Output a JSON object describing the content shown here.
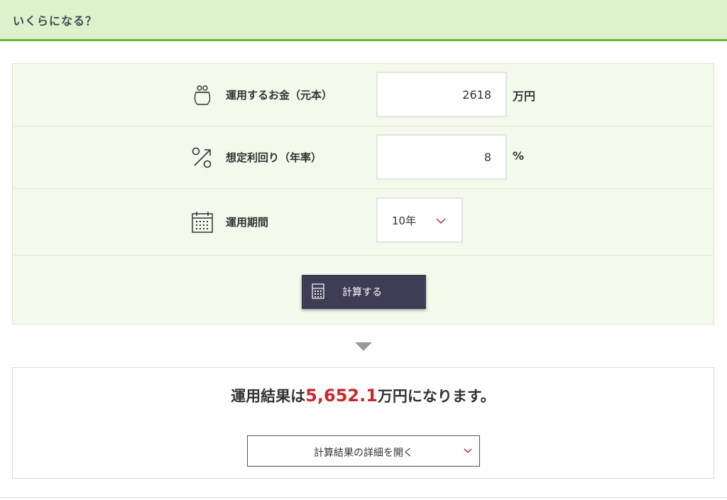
{
  "header": {
    "title": "いくらになる？"
  },
  "form": {
    "principal": {
      "label": "運用するお金（元本）",
      "value": "2618",
      "unit": "万円",
      "icon": "purse-icon"
    },
    "rate": {
      "label": "想定利回り（年率）",
      "value": "8",
      "unit": "%",
      "icon": "percent-icon"
    },
    "period": {
      "label": "運用期間",
      "selected": "10年",
      "icon": "calendar-icon"
    },
    "calculate_button": {
      "label": "計算する",
      "icon": "calculator-icon"
    }
  },
  "result": {
    "prefix": "運用結果は",
    "amount": "5,652.1",
    "suffix": "万円になります。",
    "details_button": "計算結果の詳細を開く"
  },
  "colors": {
    "header_bg": "#ddf2cc",
    "header_border": "#6db23c",
    "panel_bg": "#f3f9eb",
    "button_bg": "#3f3c55",
    "accent_red": "#c7292f"
  }
}
